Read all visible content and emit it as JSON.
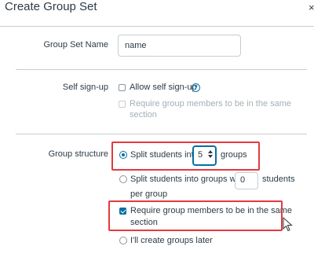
{
  "dialog": {
    "title": "Create Group Set",
    "close_glyph": "×"
  },
  "group_set_name": {
    "label": "Group Set Name",
    "value": "name"
  },
  "self_signup": {
    "label": "Self sign-up",
    "allow_label": "Allow self sign-up",
    "help_glyph": "?",
    "require_line1": "Require group members to be in the same",
    "require_line2": "section"
  },
  "group_structure": {
    "label": "Group structure",
    "split_into_prefix": "Split students into",
    "split_into_value": "5",
    "split_into_suffix": "groups",
    "split_by_prefix": "Split students into groups with",
    "split_by_value": "0",
    "split_by_suffix": "students",
    "split_by_line2": "per group",
    "require_line1": "Require group members to be in the same",
    "require_line2": "section",
    "manual_label": "I'll create groups later"
  },
  "colors": {
    "accent": "#0770a3",
    "highlight": "#e33a3f",
    "text": "#2d3b45",
    "muted": "#a5afb5",
    "divider": "#c7cdd1"
  }
}
